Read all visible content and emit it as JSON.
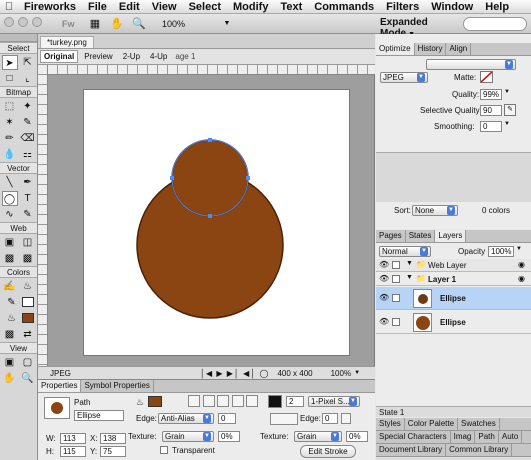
{
  "menubar": {
    "items": [
      "Fireworks",
      "File",
      "Edit",
      "View",
      "Select",
      "Modify",
      "Text",
      "Commands",
      "Filters",
      "Window",
      "Help"
    ]
  },
  "appbar": {
    "logo": "Fw",
    "zoom": "100%",
    "workspace": "Expanded Mode"
  },
  "tools": {
    "sections": [
      "Select",
      "Bitmap",
      "Vector",
      "Web",
      "Colors",
      "View"
    ]
  },
  "document": {
    "tab": "*turkey.png",
    "views": [
      "Original",
      "Preview",
      "2-Up",
      "4-Up"
    ],
    "page": "age 1",
    "format": "JPEG",
    "size": "400 x 400",
    "zoom": "100%"
  },
  "optimize": {
    "tabs": [
      "Optimize",
      "History",
      "Align"
    ],
    "format": "JPEG",
    "matte_label": "Matte:",
    "quality_label": "Quality:",
    "quality": "99%",
    "selective_label": "Selective Quality:",
    "selective": "90",
    "smoothing_label": "Smoothing:",
    "smoothing": "0",
    "sort_label": "Sort:",
    "sort": "None",
    "colors": "0 colors"
  },
  "layers": {
    "tabs": [
      "Pages",
      "States",
      "Layers"
    ],
    "blend": "Normal",
    "opacity_label": "Opacity",
    "opacity": "100%",
    "rows": [
      {
        "name": "Web Layer",
        "type": "folder"
      },
      {
        "name": "Layer 1",
        "type": "folder"
      },
      {
        "name": "Ellipse",
        "type": "object",
        "selected": true,
        "color": "#6e3a12"
      },
      {
        "name": "Ellipse",
        "type": "object",
        "selected": false,
        "color": "#8b4513"
      }
    ],
    "state": "State 1"
  },
  "bottom_right": {
    "tabs1": [
      "Styles",
      "Color Palette",
      "Swatches"
    ],
    "tabs2": [
      "Special Characters",
      "Imag",
      "Path",
      "Auto"
    ],
    "tabs3": [
      "Document Library",
      "Common Library"
    ]
  },
  "properties": {
    "tabs": [
      "Properties",
      "Symbol Properties"
    ],
    "type": "Path",
    "name": "Ellipse",
    "w": "113",
    "h": "115",
    "x": "138",
    "y": "75",
    "edge_label": "Edge:",
    "edge": "Anti-Alias",
    "edge_value": "0",
    "texture_label": "Texture:",
    "texture": "Grain",
    "texture_value": "0%",
    "transparent": "Transparent",
    "stroke_size": "2",
    "stroke_type": "1-Pixel S...",
    "stroke_edge_label": "Edge:",
    "stroke_edge": "0",
    "stroke_texture_label": "Texture:",
    "stroke_texture": "Grain",
    "stroke_texture_value": "0%",
    "edit_stroke": "Edit Stroke",
    "fill_color": "#8b4513"
  }
}
